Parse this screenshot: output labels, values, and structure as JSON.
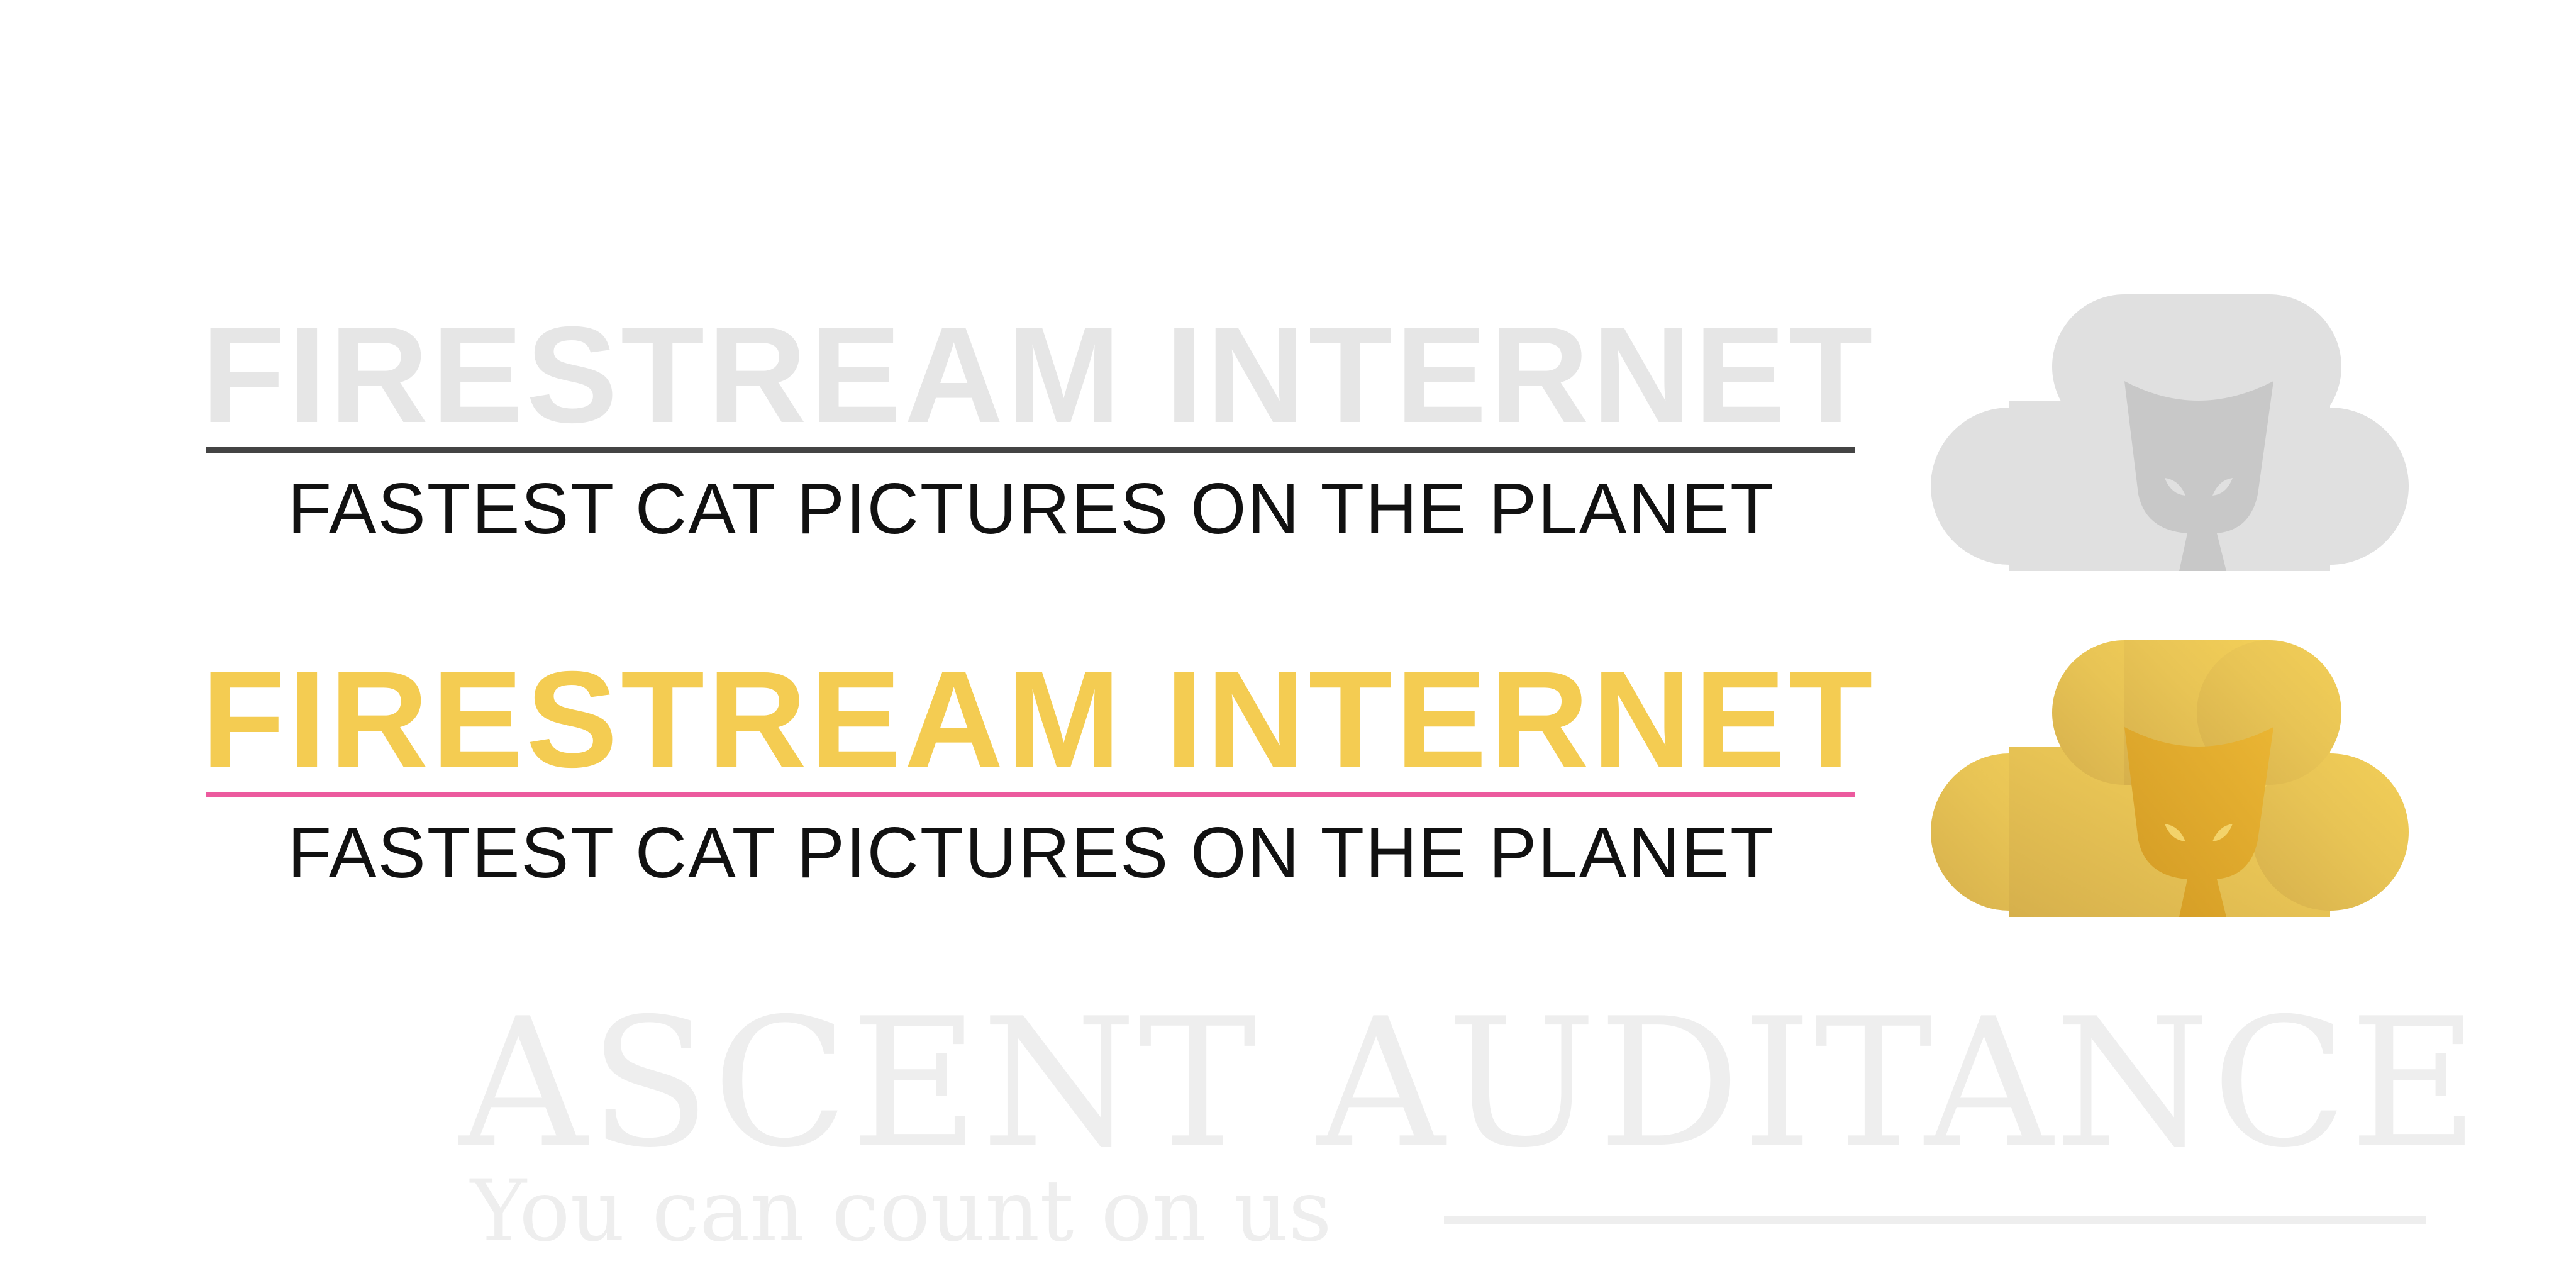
{
  "logos": [
    {
      "variant": "grey",
      "title": "FIRESTREAM INTERNET",
      "tagline": "FASTEST CAT PICTURES ON THE PLANET",
      "colors": {
        "title": "#e6e6e6",
        "rule": "#444444",
        "tagline": "#111111",
        "cloud": "#e0e0e0",
        "cat": "#c8c8c8"
      },
      "icon": "cloud-cat-icon"
    },
    {
      "variant": "color",
      "title": "FIRESTREAM INTERNET",
      "tagline": "FASTEST CAT PICTURES ON THE PLANET",
      "colors": {
        "title": "#f4cc52",
        "rule": "#ec5a9e",
        "tagline": "#111111",
        "cloud_light": "#f3cf58",
        "cloud_dark": "#d8b14c",
        "cat": "#e2ab2c"
      },
      "icon": "cloud-cat-icon"
    }
  ],
  "ascent": {
    "title": "ASCENT AUDITANCE",
    "tagline": "You can count on us",
    "color": "#eeeeee"
  }
}
